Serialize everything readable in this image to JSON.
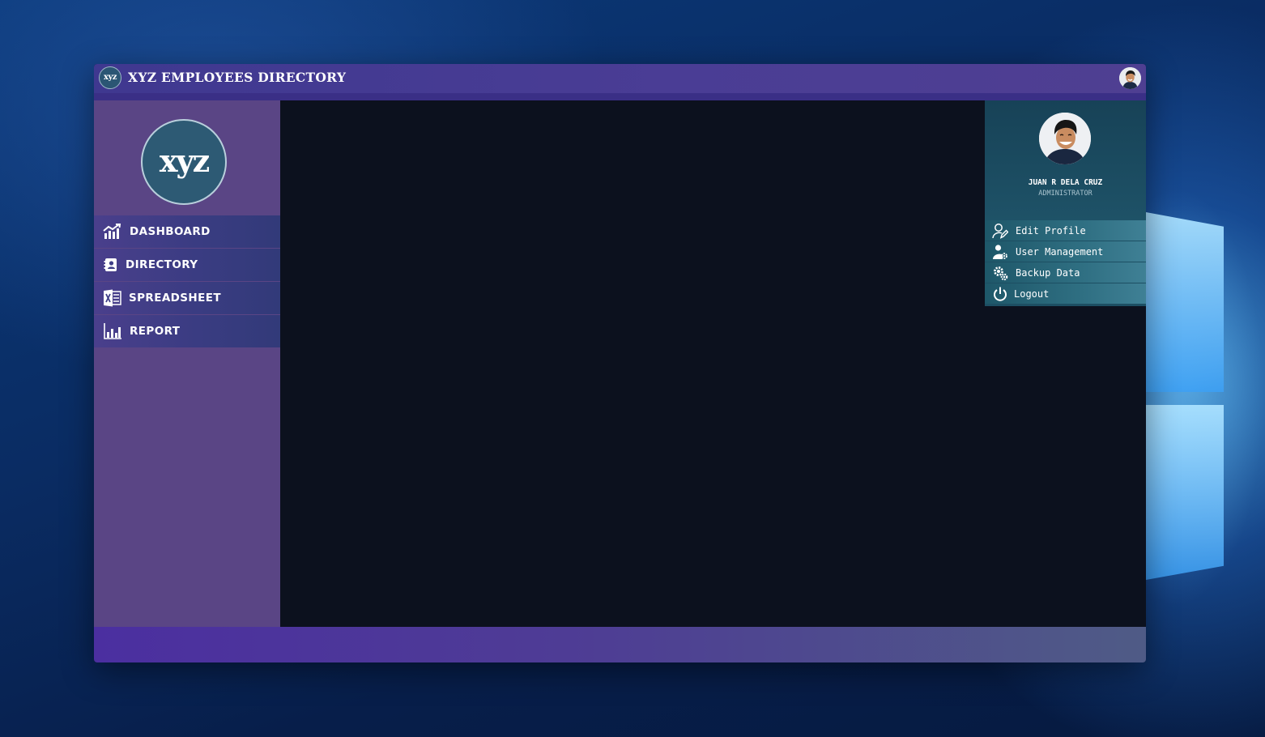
{
  "app": {
    "title": "XYZ EMPLOYEES DIRECTORY",
    "logo_text": "xyz"
  },
  "sidebar": {
    "logo_text": "xyz",
    "items": [
      {
        "label": "DASHBOARD",
        "icon": "bar-chart-growth-icon"
      },
      {
        "label": "DIRECTORY",
        "icon": "address-book-icon"
      },
      {
        "label": "SPREADSHEET",
        "icon": "excel-icon"
      },
      {
        "label": "REPORT",
        "icon": "report-chart-icon"
      }
    ]
  },
  "user_panel": {
    "name": "JUAN R DELA CRUZ",
    "role": "ADMINISTRATOR",
    "menu": [
      {
        "label": "Edit Profile",
        "icon": "user-edit-icon"
      },
      {
        "label": "User Management",
        "icon": "user-gear-icon"
      },
      {
        "label": "Backup Data",
        "icon": "gears-icon"
      },
      {
        "label": "Logout",
        "icon": "power-icon"
      }
    ]
  },
  "colors": {
    "titlebar": "#4a3d95",
    "sidebar": "#5a4585",
    "main_background": "#0c111e",
    "user_panel": "#1d4f63",
    "footer": "#4e3c95"
  }
}
